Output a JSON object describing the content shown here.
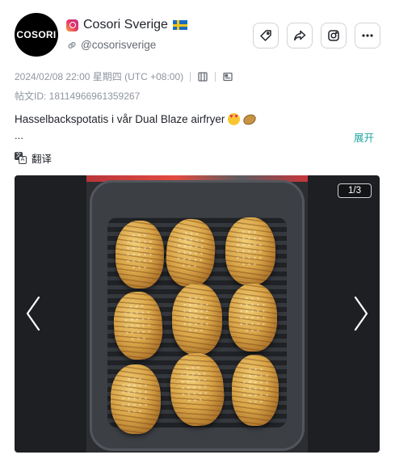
{
  "account": {
    "avatar_text": "COSORI",
    "name": "Cosori Sverige",
    "handle": "@cosorisverige",
    "platform_icon": "instagram-icon",
    "flag": "sweden-flag-emoji"
  },
  "actions": [
    {
      "name": "tag-button",
      "icon": "tag-icon"
    },
    {
      "name": "share-button",
      "icon": "share-icon"
    },
    {
      "name": "instagram-button",
      "icon": "instagram-icon"
    },
    {
      "name": "more-button",
      "icon": "more-icon"
    }
  ],
  "meta": {
    "datetime": "2024/02/08 22:00 星期四 (UTC +08:00)",
    "post_id_label": "帖文ID: ",
    "post_id": "18114966961359267"
  },
  "caption": {
    "text": "Hasselbackspotatis i vår Dual Blaze airfryer",
    "ellipsis": "...",
    "emojis": [
      "heart-eyes-emoji",
      "potato-emoji"
    ],
    "expand_label": "展开"
  },
  "translate": {
    "label": "翻译"
  },
  "media": {
    "counter": "1/3",
    "current": 1,
    "total": 3
  },
  "colors": {
    "accent": "#21a6a0",
    "muted_text": "#8f959e",
    "media_bg": "#1e1f22"
  }
}
